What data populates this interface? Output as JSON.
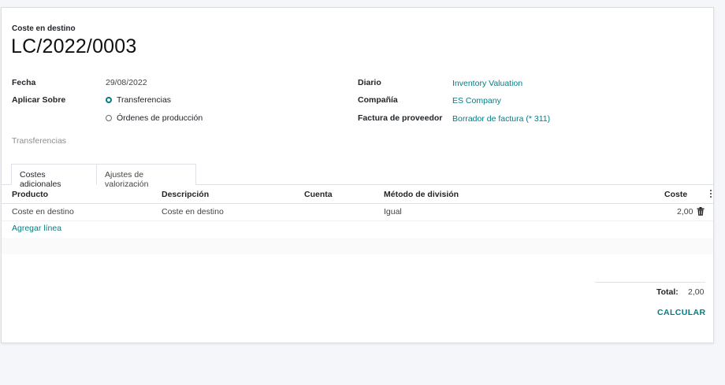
{
  "header": {
    "subtitle": "Coste en destino",
    "title": "LC/2022/0003"
  },
  "left_fields": {
    "fecha_label": "Fecha",
    "fecha_value": "29/08/2022",
    "aplicar_label": "Aplicar Sobre",
    "options": [
      {
        "label": "Transferencias",
        "checked": true
      },
      {
        "label": "Órdenes de producción",
        "checked": false
      }
    ]
  },
  "right_fields": {
    "diario_label": "Diario",
    "diario_value": "Inventory Valuation",
    "compania_label": "Compañía",
    "compania_value": "ES Company",
    "factura_label": "Factura de proveedor",
    "factura_value": "Borrador de factura (* 311)"
  },
  "section_label": "Transferencias",
  "tabs": [
    {
      "label": "Costes adicionales",
      "active": true
    },
    {
      "label": "Ajustes de valorización",
      "active": false
    }
  ],
  "table": {
    "columns": [
      "Producto",
      "Descripción",
      "Cuenta",
      "Método de división",
      "Coste"
    ],
    "rows": [
      {
        "producto": "Coste en destino",
        "descripcion": "Coste en destino",
        "cuenta": "",
        "metodo": "Igual",
        "coste": "2,00"
      }
    ],
    "add_line": "Agregar línea"
  },
  "totals": {
    "label": "Total:",
    "value": "2,00"
  },
  "actions": {
    "calcular": "CALCULAR"
  },
  "colors": {
    "accent": "#017e84",
    "background": "#f5f6f9"
  }
}
